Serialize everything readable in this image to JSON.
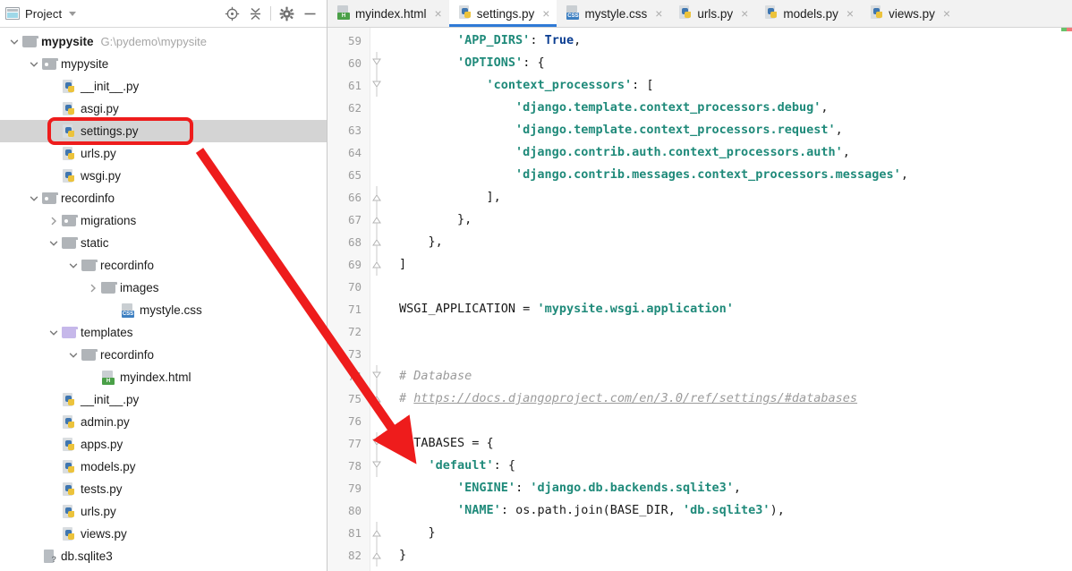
{
  "window": {
    "app": "PyCharm",
    "accent_color": "#2f7ad6",
    "annotation_color": "#ee1c1c"
  },
  "sidebar": {
    "panel_title": "Project",
    "panel_icon": "project-icon",
    "actions": [
      {
        "name": "locate-icon",
        "label": "Select Opened File"
      },
      {
        "name": "collapse-all-icon",
        "label": "Collapse All"
      },
      {
        "name": "gear-icon",
        "label": "Settings"
      },
      {
        "name": "minimize-icon",
        "label": "Hide"
      }
    ],
    "tree": [
      {
        "label": "mypysite",
        "hint": "G:\\pydemo\\mypysite",
        "depth": 0,
        "icon": "folder",
        "arrow": "down",
        "bold": true,
        "selected": false
      },
      {
        "label": "mypysite",
        "hint": "",
        "depth": 1,
        "icon": "folder-module",
        "arrow": "down",
        "bold": false,
        "selected": false
      },
      {
        "label": "__init__.py",
        "hint": "",
        "depth": 2,
        "icon": "python-file",
        "arrow": "none",
        "bold": false,
        "selected": false
      },
      {
        "label": "asgi.py",
        "hint": "",
        "depth": 2,
        "icon": "python-file",
        "arrow": "none",
        "bold": false,
        "selected": false
      },
      {
        "label": "settings.py",
        "hint": "",
        "depth": 2,
        "icon": "python-file",
        "arrow": "none",
        "bold": false,
        "selected": true
      },
      {
        "label": "urls.py",
        "hint": "",
        "depth": 2,
        "icon": "python-file",
        "arrow": "none",
        "bold": false,
        "selected": false
      },
      {
        "label": "wsgi.py",
        "hint": "",
        "depth": 2,
        "icon": "python-file",
        "arrow": "none",
        "bold": false,
        "selected": false
      },
      {
        "label": "recordinfo",
        "hint": "",
        "depth": 1,
        "icon": "folder-module",
        "arrow": "down",
        "bold": false,
        "selected": false
      },
      {
        "label": "migrations",
        "hint": "",
        "depth": 2,
        "icon": "folder-module",
        "arrow": "right",
        "bold": false,
        "selected": false
      },
      {
        "label": "static",
        "hint": "",
        "depth": 2,
        "icon": "folder",
        "arrow": "down",
        "bold": false,
        "selected": false
      },
      {
        "label": "recordinfo",
        "hint": "",
        "depth": 3,
        "icon": "folder",
        "arrow": "down",
        "bold": false,
        "selected": false
      },
      {
        "label": "images",
        "hint": "",
        "depth": 4,
        "icon": "folder",
        "arrow": "right",
        "bold": false,
        "selected": false
      },
      {
        "label": "mystyle.css",
        "hint": "",
        "depth": 5,
        "icon": "css-file",
        "arrow": "none",
        "bold": false,
        "selected": false
      },
      {
        "label": "templates",
        "hint": "",
        "depth": 2,
        "icon": "folder-template",
        "arrow": "down",
        "bold": false,
        "selected": false
      },
      {
        "label": "recordinfo",
        "hint": "",
        "depth": 3,
        "icon": "folder",
        "arrow": "down",
        "bold": false,
        "selected": false
      },
      {
        "label": "myindex.html",
        "hint": "",
        "depth": 4,
        "icon": "html-file",
        "arrow": "none",
        "bold": false,
        "selected": false
      },
      {
        "label": "__init__.py",
        "hint": "",
        "depth": 2,
        "icon": "python-file",
        "arrow": "none",
        "bold": false,
        "selected": false
      },
      {
        "label": "admin.py",
        "hint": "",
        "depth": 2,
        "icon": "python-file",
        "arrow": "none",
        "bold": false,
        "selected": false
      },
      {
        "label": "apps.py",
        "hint": "",
        "depth": 2,
        "icon": "python-file",
        "arrow": "none",
        "bold": false,
        "selected": false
      },
      {
        "label": "models.py",
        "hint": "",
        "depth": 2,
        "icon": "python-file",
        "arrow": "none",
        "bold": false,
        "selected": false
      },
      {
        "label": "tests.py",
        "hint": "",
        "depth": 2,
        "icon": "python-file",
        "arrow": "none",
        "bold": false,
        "selected": false
      },
      {
        "label": "urls.py",
        "hint": "",
        "depth": 2,
        "icon": "python-file",
        "arrow": "none",
        "bold": false,
        "selected": false
      },
      {
        "label": "views.py",
        "hint": "",
        "depth": 2,
        "icon": "python-file",
        "arrow": "none",
        "bold": false,
        "selected": false
      },
      {
        "label": "db.sqlite3",
        "hint": "",
        "depth": 1,
        "icon": "db-file",
        "arrow": "none",
        "bold": false,
        "selected": false
      }
    ]
  },
  "editor": {
    "tabs": [
      {
        "label": "myindex.html",
        "icon": "html-file",
        "active": false,
        "close": "×"
      },
      {
        "label": "settings.py",
        "icon": "python-file",
        "active": true,
        "close": "×"
      },
      {
        "label": "mystyle.css",
        "icon": "css-file",
        "active": false,
        "close": "×"
      },
      {
        "label": "urls.py",
        "icon": "python-file",
        "active": false,
        "close": "×"
      },
      {
        "label": "models.py",
        "icon": "python-file",
        "active": false,
        "close": "×"
      },
      {
        "label": "views.py",
        "icon": "python-file",
        "active": false,
        "close": "×"
      }
    ],
    "first_line_number": 59,
    "lines": [
      {
        "n": 59,
        "fold": "none",
        "tokens": [
          {
            "t": "        ",
            "c": "pl"
          },
          {
            "t": "'APP_DIRS'",
            "c": "str"
          },
          {
            "t": ": ",
            "c": "pl"
          },
          {
            "t": "True",
            "c": "kw"
          },
          {
            "t": ",",
            "c": "pl"
          }
        ]
      },
      {
        "n": 60,
        "fold": "open",
        "tokens": [
          {
            "t": "        ",
            "c": "pl"
          },
          {
            "t": "'OPTIONS'",
            "c": "str"
          },
          {
            "t": ": {",
            "c": "pl"
          }
        ]
      },
      {
        "n": 61,
        "fold": "open",
        "tokens": [
          {
            "t": "            ",
            "c": "pl"
          },
          {
            "t": "'context_processors'",
            "c": "str"
          },
          {
            "t": ": [",
            "c": "pl"
          }
        ]
      },
      {
        "n": 62,
        "fold": "none",
        "tokens": [
          {
            "t": "                ",
            "c": "pl"
          },
          {
            "t": "'django.template.context_processors.debug'",
            "c": "str"
          },
          {
            "t": ",",
            "c": "pl"
          }
        ]
      },
      {
        "n": 63,
        "fold": "none",
        "tokens": [
          {
            "t": "                ",
            "c": "pl"
          },
          {
            "t": "'django.template.context_processors.request'",
            "c": "str"
          },
          {
            "t": ",",
            "c": "pl"
          }
        ]
      },
      {
        "n": 64,
        "fold": "none",
        "tokens": [
          {
            "t": "                ",
            "c": "pl"
          },
          {
            "t": "'django.contrib.auth.context_processors.auth'",
            "c": "str"
          },
          {
            "t": ",",
            "c": "pl"
          }
        ]
      },
      {
        "n": 65,
        "fold": "none",
        "tokens": [
          {
            "t": "                ",
            "c": "pl"
          },
          {
            "t": "'django.contrib.messages.context_processors.messages'",
            "c": "str"
          },
          {
            "t": ",",
            "c": "pl"
          }
        ]
      },
      {
        "n": 66,
        "fold": "close",
        "tokens": [
          {
            "t": "            ],",
            "c": "pl"
          }
        ]
      },
      {
        "n": 67,
        "fold": "close",
        "tokens": [
          {
            "t": "        },",
            "c": "pl"
          }
        ]
      },
      {
        "n": 68,
        "fold": "close",
        "tokens": [
          {
            "t": "    },",
            "c": "pl"
          }
        ]
      },
      {
        "n": 69,
        "fold": "close",
        "tokens": [
          {
            "t": "]",
            "c": "pl"
          }
        ]
      },
      {
        "n": 70,
        "fold": "none",
        "tokens": [
          {
            "t": "",
            "c": "pl"
          }
        ]
      },
      {
        "n": 71,
        "fold": "none",
        "tokens": [
          {
            "t": "WSGI_APPLICATION = ",
            "c": "pl"
          },
          {
            "t": "'mypysite.wsgi.application'",
            "c": "str"
          }
        ]
      },
      {
        "n": 72,
        "fold": "none",
        "tokens": [
          {
            "t": "",
            "c": "pl"
          }
        ]
      },
      {
        "n": 73,
        "fold": "none",
        "tokens": [
          {
            "t": "",
            "c": "pl"
          }
        ]
      },
      {
        "n": 74,
        "fold": "open",
        "tokens": [
          {
            "t": "# Database",
            "c": "cm"
          }
        ]
      },
      {
        "n": 75,
        "fold": "close",
        "tokens": [
          {
            "t": "# ",
            "c": "cm"
          },
          {
            "t": "https://docs.djangoproject.com/en/3.0/ref/settings/#databases",
            "c": "url"
          }
        ]
      },
      {
        "n": 76,
        "fold": "none",
        "tokens": [
          {
            "t": "",
            "c": "pl"
          }
        ]
      },
      {
        "n": 77,
        "fold": "open",
        "tokens": [
          {
            "t": "DATABASES = {",
            "c": "pl"
          }
        ]
      },
      {
        "n": 78,
        "fold": "open",
        "tokens": [
          {
            "t": "    ",
            "c": "pl"
          },
          {
            "t": "'default'",
            "c": "str"
          },
          {
            "t": ": {",
            "c": "pl"
          }
        ]
      },
      {
        "n": 79,
        "fold": "none",
        "tokens": [
          {
            "t": "        ",
            "c": "pl"
          },
          {
            "t": "'ENGINE'",
            "c": "str"
          },
          {
            "t": ": ",
            "c": "pl"
          },
          {
            "t": "'django.db.backends.sqlite3'",
            "c": "str"
          },
          {
            "t": ",",
            "c": "pl"
          }
        ]
      },
      {
        "n": 80,
        "fold": "none",
        "tokens": [
          {
            "t": "        ",
            "c": "pl"
          },
          {
            "t": "'NAME'",
            "c": "str"
          },
          {
            "t": ": os.path.join(BASE_DIR, ",
            "c": "pl"
          },
          {
            "t": "'db.sqlite3'",
            "c": "str"
          },
          {
            "t": "),",
            "c": "pl"
          }
        ]
      },
      {
        "n": 81,
        "fold": "close",
        "tokens": [
          {
            "t": "    }",
            "c": "pl"
          }
        ]
      },
      {
        "n": 82,
        "fold": "close",
        "tokens": [
          {
            "t": "}",
            "c": "pl"
          }
        ]
      }
    ]
  },
  "annotations": {
    "highlight_box": {
      "name": "settings-py-highlight",
      "target": "settings.py"
    },
    "arrow": {
      "name": "pointer-arrow",
      "from": "settings.py",
      "to": "DATABASES"
    }
  }
}
